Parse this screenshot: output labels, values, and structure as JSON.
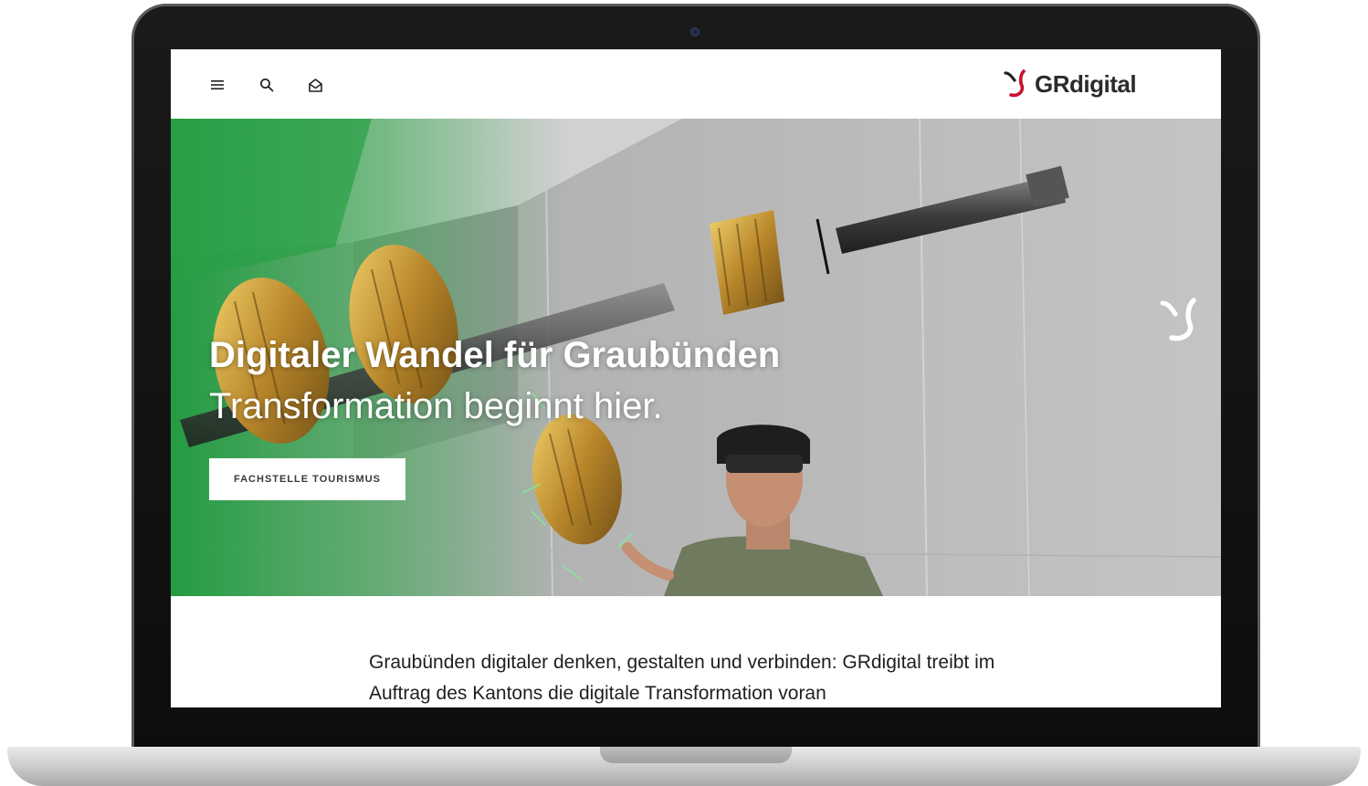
{
  "header": {
    "menu_icon": "hamburger-menu-icon",
    "search_icon": "search-icon",
    "inbox_icon": "mail-inbox-icon",
    "logo_text": "GRdigital",
    "logo_color": "#c8102e"
  },
  "hero": {
    "title": "Digitaler Wandel für Graubünden",
    "subtitle": "Transformation beginnt hier.",
    "button_label": "FACHSTELLE TOURISMUS",
    "accent_green": "#2fa84a",
    "mark_icon": "grdigital-mark-icon"
  },
  "intro": {
    "text": "Graubünden digitaler denken, gestalten und verbinden: GRdigital treibt im Auftrag des Kantons die digitale Transformation voran"
  }
}
